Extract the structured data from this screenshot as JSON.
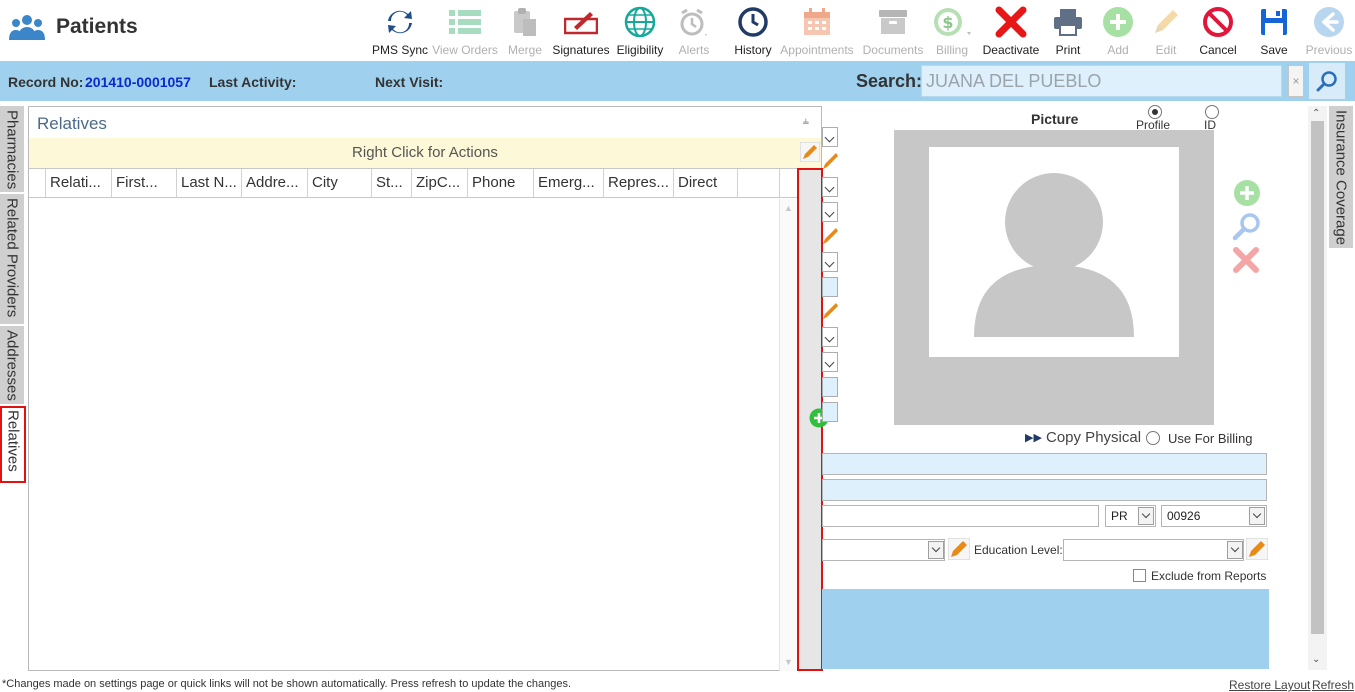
{
  "app": {
    "title": "Patients"
  },
  "toolbar": {
    "pms_sync": "PMS Sync",
    "view_orders": "View Orders",
    "merge": "Merge",
    "signatures": "Signatures",
    "eligibility": "Eligibility",
    "alerts": "Alerts",
    "history": "History",
    "appointments": "Appointments",
    "documents": "Documents",
    "billing": "Billing",
    "deactivate": "Deactivate",
    "print": "Print",
    "add": "Add",
    "edit": "Edit",
    "cancel": "Cancel",
    "save": "Save",
    "previous": "Previous"
  },
  "record_bar": {
    "record_no_label": "Record No:",
    "record_no_value": "201410-0001057",
    "last_activity_label": "Last Activity:",
    "next_visit_label": "Next Visit:",
    "search_label": "Search:",
    "search_value": "JUANA DEL PUEBLO",
    "search_clear": "×"
  },
  "side_tabs": [
    "Pharmacies",
    "Related Providers",
    "Addresses",
    "Relatives"
  ],
  "right_tab": "Insurance Coverage",
  "relatives": {
    "title": "Relatives",
    "actions_hint": "Right Click for Actions",
    "columns": [
      "Relati...",
      "First...",
      "Last N...",
      "Addre...",
      "City",
      "St...",
      "ZipC...",
      "Phone",
      "Emerg...",
      "Repres...",
      "Direct"
    ]
  },
  "picture": {
    "label": "Picture",
    "profile": "Profile",
    "id": "ID"
  },
  "address": {
    "copy_physical": "Copy Physical",
    "use_for_billing": "Use For Billing",
    "state": "PR",
    "zip": "00926",
    "education_label": "Education Level:",
    "exclude_reports": "Exclude from Reports"
  },
  "footer": {
    "note": "*Changes made on settings page or quick links will not be shown automatically. Press refresh to update the changes.",
    "restore_layout": "Restore Layout",
    "refresh": "Refresh"
  },
  "colors": {
    "accent_blue": "#9fd1ee",
    "record_link": "#0a2ad0",
    "highlight_red": "#e01313",
    "add_green": "#2fbf3a"
  }
}
